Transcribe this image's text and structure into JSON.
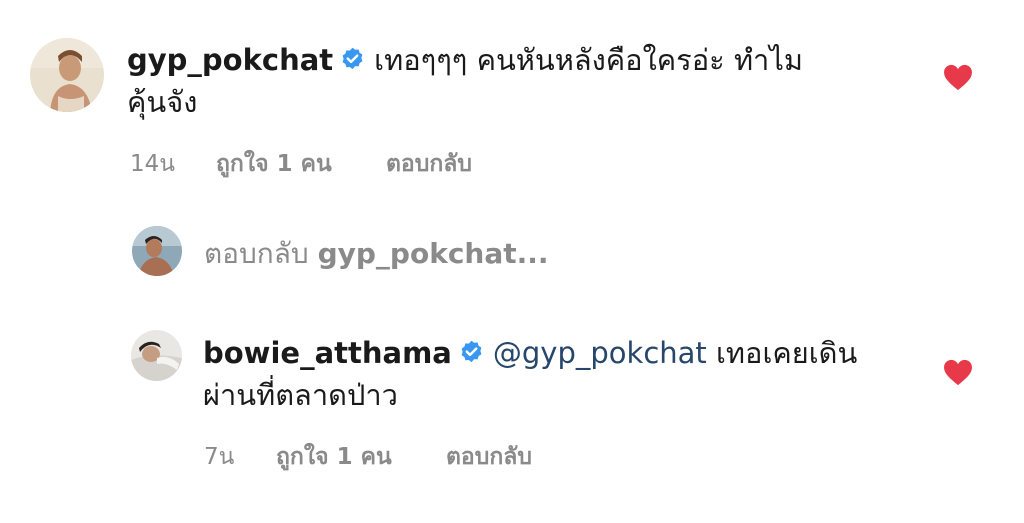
{
  "comments": [
    {
      "username": "gyp_pokchat",
      "verified": true,
      "text_line1": "เทอๆๆๆ คนหันหลังคือใครอ่ะ ทำไม",
      "text_line2": "คุ้นจัง",
      "time": "14น",
      "likes": "ถูกใจ 1 คน",
      "reply": "ตอบกลับ",
      "liked": true,
      "avatar_icon": "profile-photo"
    },
    {
      "username": "bowie_atthama",
      "verified": true,
      "mention": "@gyp_pokchat",
      "text_line1": "เทอเคยเดิน",
      "text_line2": "ผ่านที่ตลาดป่าว",
      "time": "7น",
      "likes": "ถูกใจ 1 คน",
      "reply": "ตอบกลับ",
      "liked": true,
      "avatar_icon": "profile-photo"
    }
  ],
  "reply_prompt": {
    "prefix": "ตอบกลับ",
    "target": "gyp_pokchat..."
  },
  "colors": {
    "heart": "#e8394a",
    "verified": "#3897f0",
    "mention": "#27466b",
    "meta": "#8a8a8a"
  }
}
